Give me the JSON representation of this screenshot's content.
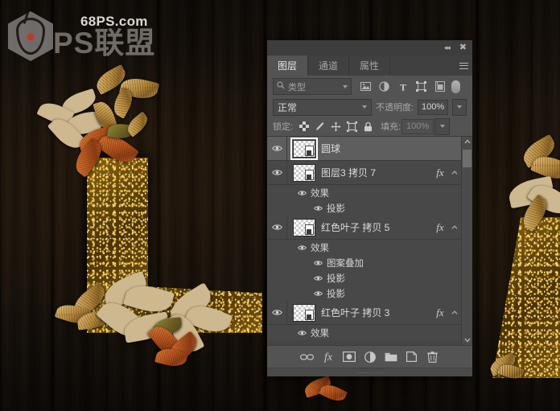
{
  "watermark": {
    "domain": "68PS.com",
    "brand": "PS联盟",
    "logo_icon": "flame-hexagon-logo-icon"
  },
  "panel": {
    "titlebar": {
      "collapse_label": "◂◂",
      "collapse_icon": "collapse-to-icons-icon",
      "close_label": "✖",
      "close_icon": "close-icon"
    },
    "tabs": [
      {
        "label": "图层",
        "name": "tab-layers",
        "active": true
      },
      {
        "label": "通道",
        "name": "tab-channels",
        "active": false
      },
      {
        "label": "属性",
        "name": "tab-properties",
        "active": false
      }
    ],
    "menu_icon": "panel-menu-hamburger-icon",
    "filter": {
      "search_icon": "search-icon",
      "kind_value": "类型",
      "caret_icon": "chevron-down-icon",
      "icons": [
        {
          "name": "filter-pixel-icon",
          "title": "pixel-layers"
        },
        {
          "name": "filter-adjustment-icon",
          "title": "adjustment-layers"
        },
        {
          "name": "filter-type-icon",
          "title": "type-layers",
          "glyph": "T"
        },
        {
          "name": "filter-shape-icon",
          "title": "shape-layers"
        },
        {
          "name": "filter-smartobject-icon",
          "title": "smart-objects"
        }
      ],
      "toggle_name": "filter-enable-toggle"
    },
    "blend": {
      "mode_value": "正常",
      "opacity_label": "不透明度:",
      "opacity_value": "100%",
      "caret_icon": "chevron-down-icon"
    },
    "lock": {
      "label": "锁定:",
      "icons": [
        {
          "name": "lock-transparent-pixels-icon"
        },
        {
          "name": "lock-image-pixels-icon"
        },
        {
          "name": "lock-position-icon"
        },
        {
          "name": "lock-artboard-nesting-icon"
        },
        {
          "name": "lock-all-icon"
        }
      ],
      "fill_label": "填充:",
      "fill_value": "100%"
    },
    "layers": [
      {
        "name": "圆球",
        "selected": true,
        "visible": true,
        "has_fx": false,
        "effects": []
      },
      {
        "name": "图层3 拷贝 7",
        "selected": false,
        "visible": true,
        "has_fx": true,
        "fx_label": "fx",
        "effects": [
          {
            "label": "效果",
            "level": 1
          },
          {
            "label": "投影",
            "level": 2
          }
        ]
      },
      {
        "name": "红色叶子 拷贝 5",
        "selected": false,
        "visible": true,
        "has_fx": true,
        "fx_label": "fx",
        "effects": [
          {
            "label": "效果",
            "level": 1
          },
          {
            "label": "图案叠加",
            "level": 2
          },
          {
            "label": "投影",
            "level": 2
          },
          {
            "label": "投影",
            "level": 2
          }
        ]
      },
      {
        "name": "红色叶子 拷贝 3",
        "selected": false,
        "visible": true,
        "has_fx": true,
        "fx_label": "fx",
        "effects": [
          {
            "label": "效果",
            "level": 1
          }
        ]
      }
    ],
    "scrollbar": {
      "up_icon": "chevron-up-icon",
      "down_icon": "chevron-down-icon"
    },
    "bottom_toolbar": [
      {
        "name": "link-layers-button",
        "icon": "link-icon"
      },
      {
        "name": "add-layer-style-button",
        "icon": "fx-icon",
        "glyph": "fx"
      },
      {
        "name": "add-layer-mask-button",
        "icon": "layer-mask-icon"
      },
      {
        "name": "new-fill-adjustment-button",
        "icon": "half-circle-icon"
      },
      {
        "name": "new-group-button",
        "icon": "folder-icon"
      },
      {
        "name": "new-layer-button",
        "icon": "new-layer-icon"
      },
      {
        "name": "delete-layer-button",
        "icon": "trash-icon"
      }
    ]
  },
  "colors": {
    "panel_bg": "#535353",
    "list_bg": "#484848",
    "selected_row": "#5e5e5e",
    "tab_active_text": "#e8e8e8",
    "glitter_gold": "#b58a3e"
  }
}
